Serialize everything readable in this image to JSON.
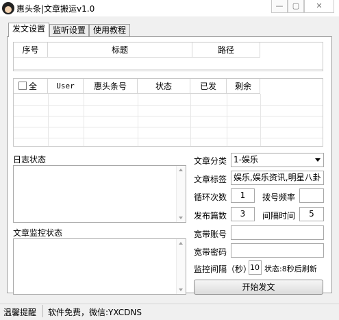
{
  "window": {
    "title": "惠头条|文章搬运v1.0",
    "minimize_glyph": "—",
    "maximize_glyph": "▢",
    "close_glyph": "✕"
  },
  "tabs": [
    {
      "label": "发文设置",
      "active": true
    },
    {
      "label": "监听设置",
      "active": false
    },
    {
      "label": "使用教程",
      "active": false
    }
  ],
  "article_table": {
    "columns": [
      "序号",
      "标题",
      "路径"
    ]
  },
  "account_table": {
    "select_all_label": "全",
    "columns": [
      "User",
      "惠头条号",
      "状态",
      "已发",
      "剩余"
    ]
  },
  "log": {
    "label": "日志状态"
  },
  "monitor_log": {
    "label": "文章监控状态"
  },
  "form": {
    "category_label": "文章分类",
    "category_value": "1-娱乐",
    "tags_label": "文章标签",
    "tags_value": "娱乐,娱乐资讯,明星八卦",
    "loop_label": "循环次数",
    "loop_value": "1",
    "dial_label": "拨号频率",
    "dial_value": "",
    "publish_label": "发布篇数",
    "publish_value": "3",
    "interval_label": "间隔时间",
    "interval_value": "5",
    "broadband_account_label": "宽带账号",
    "broadband_account_value": "",
    "broadband_password_label": "宽带密码",
    "broadband_password_value": "",
    "monitor_interval_label": "监控间隔（秒）",
    "monitor_interval_value": "10",
    "monitor_status": "状态:8秒后刷新",
    "start_button": "开始发文"
  },
  "statusbar": {
    "tip_label": "温馨提醒",
    "message": "软件免费，微信:YXCDNS"
  }
}
